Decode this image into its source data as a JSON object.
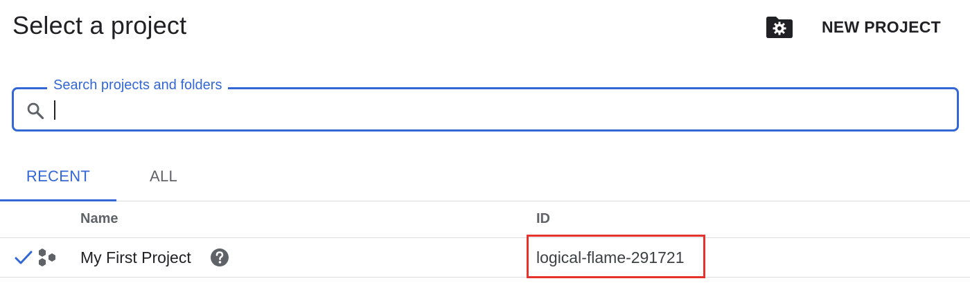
{
  "header": {
    "title": "Select a project",
    "new_project_icon": "folder-gear-icon",
    "new_project_label": "NEW PROJECT"
  },
  "search": {
    "label": "Search projects and folders",
    "value": "",
    "placeholder": "",
    "icon": "search-icon"
  },
  "tabs": [
    {
      "label": "RECENT",
      "active": true
    },
    {
      "label": "ALL",
      "active": false
    }
  ],
  "table": {
    "columns": [
      "Name",
      "ID"
    ],
    "rows": [
      {
        "selected": true,
        "name": "My First Project",
        "id": "logical-flame-291721",
        "highlighted_id": true
      }
    ]
  },
  "colors": {
    "accent": "#3367d6",
    "highlight": "#e5322d",
    "text": "#202124",
    "muted": "#5f6368",
    "divider": "#dadce0"
  }
}
